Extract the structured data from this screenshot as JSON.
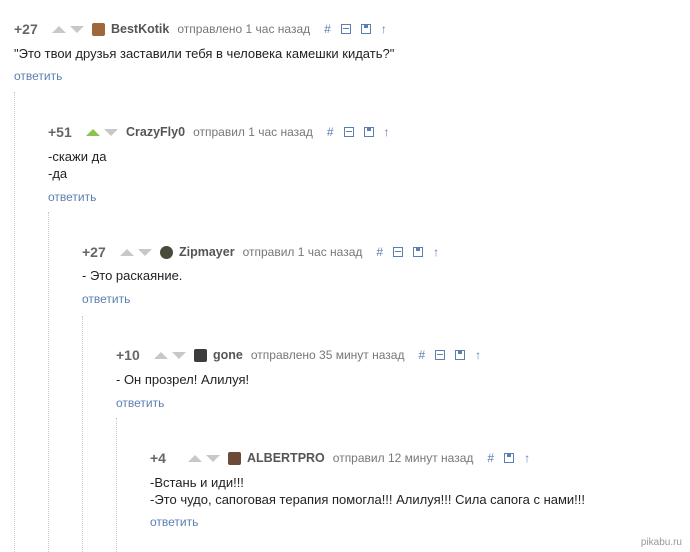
{
  "actions": {
    "link": "#",
    "up": "↑",
    "reply": "ответить"
  },
  "comments": [
    {
      "rating": "+27",
      "author": "BestKotik",
      "time": "отправлено 1 час назад",
      "lines": [
        "\"Это твои друзья заставили тебя в человека камешки кидать?\""
      ]
    },
    {
      "rating": "+51",
      "author": "CrazyFly0",
      "time": "отправил 1 час назад",
      "lines": [
        "-скажи да",
        "-да"
      ]
    },
    {
      "rating": "+27",
      "author": "Zipmayer",
      "time": "отправил 1 час назад",
      "lines": [
        "- Это раскаяние."
      ]
    },
    {
      "rating": "+10",
      "author": "gone",
      "time": "отправлено 35 минут назад",
      "lines": [
        "- Он прозрел! Алилуя!"
      ]
    },
    {
      "rating": "+4",
      "author": "ALBERTPRO",
      "time": "отправил 12 минут назад",
      "lines": [
        "-Встань и иди!!!",
        "-Это чудо, сапоговая терапия помогла!!! Алилуя!!! Сила сапога с нами!!!"
      ]
    }
  ],
  "watermark": "pikabu.ru",
  "colors": {
    "accent": "#5a7fb0",
    "vote_active": "#8cc34b",
    "rating": "#666666"
  }
}
